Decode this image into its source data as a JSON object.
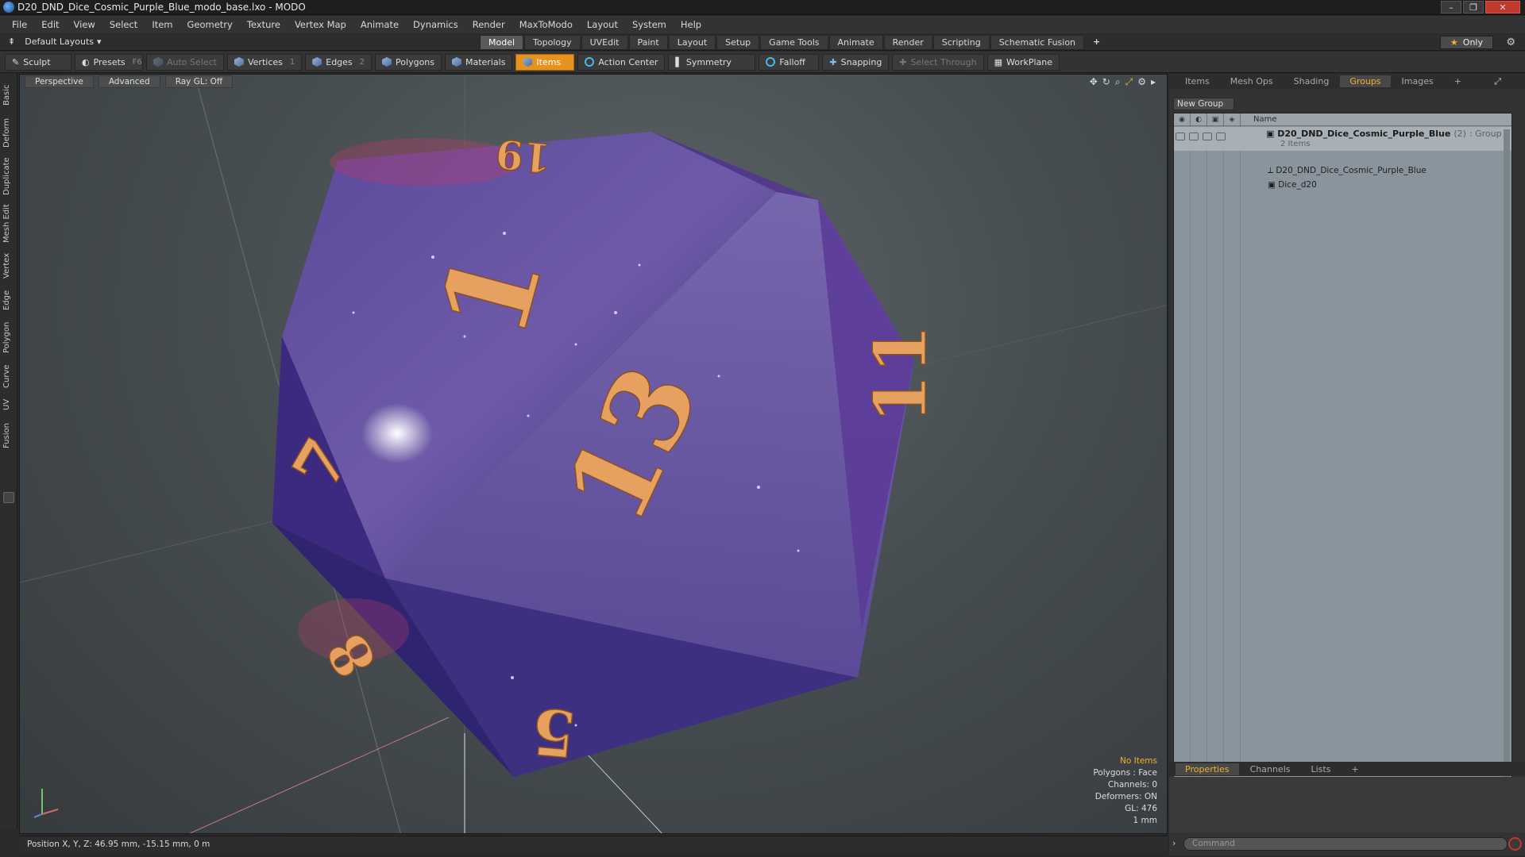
{
  "window": {
    "title": "D20_DND_Dice_Cosmic_Purple_Blue_modo_base.lxo - MODO",
    "controls": [
      "minimize",
      "maximize",
      "close"
    ]
  },
  "menu": [
    "File",
    "Edit",
    "View",
    "Select",
    "Item",
    "Geometry",
    "Texture",
    "Vertex Map",
    "Animate",
    "Dynamics",
    "Render",
    "MaxToModo",
    "Layout",
    "System",
    "Help"
  ],
  "layout": {
    "preset": "Default Layouts",
    "modes": [
      "Model",
      "Topology",
      "UVEdit",
      "Paint",
      "Layout",
      "Setup",
      "Game Tools",
      "Animate",
      "Render",
      "Scripting",
      "Schematic Fusion"
    ],
    "active_mode": "Model",
    "only_label": "Only"
  },
  "toolbar": {
    "sculpt": "Sculpt",
    "presets": "Presets",
    "presets_key": "F6",
    "auto_select": "Auto Select",
    "vertices": "Vertices",
    "vertices_key": "1",
    "edges": "Edges",
    "edges_key": "2",
    "polygons": "Polygons",
    "materials": "Materials",
    "items": "Items",
    "action_center": "Action Center",
    "symmetry": "Symmetry",
    "falloff": "Falloff",
    "snapping": "Snapping",
    "select_through": "Select Through",
    "workplane": "WorkPlane"
  },
  "left_tabs": [
    "Basic",
    "Deform",
    "Duplicate",
    "Mesh Edit",
    "Vertex",
    "Edge",
    "Polygon",
    "Curve",
    "UV",
    "Fusion"
  ],
  "viewport": {
    "view": "Perspective",
    "shading": "Advanced",
    "raygl": "Ray GL: Off",
    "stats": {
      "items": "No Items",
      "polygons": "Polygons : Face",
      "channels": "Channels: 0",
      "deformers": "Deformers: ON",
      "gl": "GL: 476",
      "scale": "1 mm"
    },
    "dice_numbers": [
      "19",
      "1",
      "13",
      "11",
      "7",
      "5",
      "8"
    ]
  },
  "status": {
    "position": "Position X, Y, Z:  46.95 mm, -15.15 mm, 0 m"
  },
  "right_panel": {
    "tabs": [
      "Items",
      "Mesh Ops",
      "Shading",
      "Groups",
      "Images"
    ],
    "active_tab": "Groups",
    "new_group": "New Group",
    "column_name": "Name",
    "group": {
      "name": "D20_DND_Dice_Cosmic_Purple_Blue",
      "count": "(2)",
      "type": ": Group",
      "subtitle": "2 Items",
      "children": [
        "D20_DND_Dice_Cosmic_Purple_Blue",
        "Dice_d20"
      ]
    },
    "bottom_tabs": [
      "Properties",
      "Channels",
      "Lists"
    ],
    "active_bottom_tab": "Properties",
    "command_placeholder": "Command"
  },
  "colors": {
    "accent": "#f0b030",
    "items_button": "#e8921e"
  }
}
